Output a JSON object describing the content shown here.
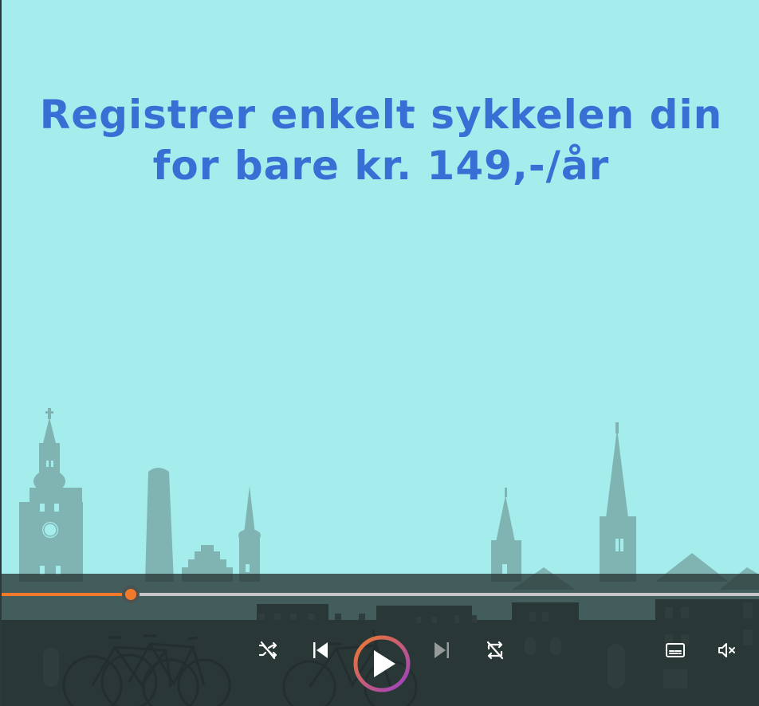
{
  "headline": {
    "line1": "Registrer enkelt sykkelen din",
    "line2": "for bare kr. 149,-/år"
  },
  "colors": {
    "background": "#a5ecec",
    "headline": "#3770d4",
    "accent": "#f07a2a",
    "play_ring_end": "#9a3fc7"
  },
  "player": {
    "progress": 0.17,
    "controls": {
      "shuffle_icon": "shuffle-icon",
      "previous_icon": "skip-previous-icon",
      "play_icon": "play-icon",
      "next_icon": "skip-next-icon",
      "repeat_icon": "repeat-off-icon",
      "subtitles_icon": "subtitles-icon",
      "mute_icon": "volume-muted-icon"
    }
  }
}
